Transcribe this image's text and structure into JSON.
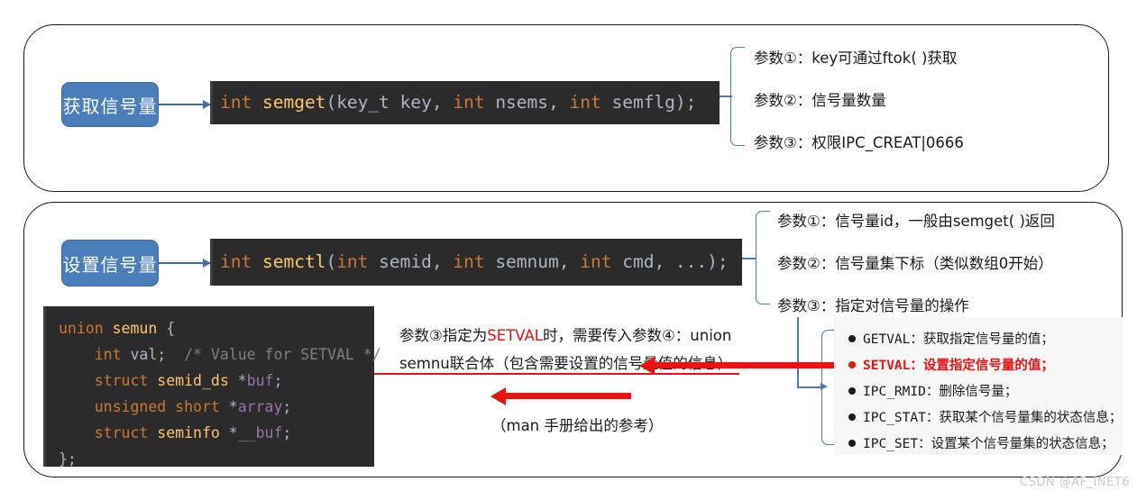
{
  "panels": {
    "semget": {
      "label": "获取信号量",
      "code_plain": "int semget(key_t key, int nsems, int semflg);",
      "code_tokens": [
        {
          "t": "int",
          "c": "kw"
        },
        {
          "t": " ",
          "c": "pn"
        },
        {
          "t": "semget",
          "c": "fn"
        },
        {
          "t": "(",
          "c": "pn"
        },
        {
          "t": "key_t",
          "c": "id"
        },
        {
          "t": " key, ",
          "c": "id"
        },
        {
          "t": "int",
          "c": "kw"
        },
        {
          "t": " nsems, ",
          "c": "id"
        },
        {
          "t": "int",
          "c": "kw"
        },
        {
          "t": " semflg);",
          "c": "id"
        }
      ],
      "annotations": [
        "参数①：key可通过ftok( )获取",
        "参数②：信号量数量",
        "参数③：权限IPC_CREAT|0666"
      ]
    },
    "semctl": {
      "label": "设置信号量",
      "code_plain": "int semctl(int semid, int semnum, int cmd, ...);",
      "code_tokens": [
        {
          "t": "int",
          "c": "kw"
        },
        {
          "t": " ",
          "c": "pn"
        },
        {
          "t": "semctl",
          "c": "fn"
        },
        {
          "t": "(",
          "c": "pn"
        },
        {
          "t": "int",
          "c": "kw"
        },
        {
          "t": " semid, ",
          "c": "id"
        },
        {
          "t": "int",
          "c": "kw"
        },
        {
          "t": " semnum, ",
          "c": "id"
        },
        {
          "t": "int",
          "c": "kw"
        },
        {
          "t": " cmd, ...);",
          "c": "id"
        }
      ],
      "annotations": [
        "参数①：信号量id，一般由semget( )返回",
        "参数②：信号量集下标（类似数组0开始）",
        "参数③：指定对信号量的操作"
      ]
    }
  },
  "union_code": {
    "lines": [
      [
        {
          "t": "union",
          "c": "kw"
        },
        {
          "t": " ",
          "c": "pn"
        },
        {
          "t": "semun",
          "c": "fn"
        },
        {
          "t": " {",
          "c": "pn"
        }
      ],
      [
        {
          "t": "    ",
          "c": "pn"
        },
        {
          "t": "int",
          "c": "kw"
        },
        {
          "t": " val;  ",
          "c": "id"
        },
        {
          "t": "/* Value for SETVAL */",
          "c": "cm"
        }
      ],
      [
        {
          "t": "    ",
          "c": "pn"
        },
        {
          "t": "struct",
          "c": "kw"
        },
        {
          "t": " ",
          "c": "pn"
        },
        {
          "t": "semid_ds",
          "c": "fn"
        },
        {
          "t": " *",
          "c": "pn"
        },
        {
          "t": "buf",
          "c": "ptr"
        },
        {
          "t": ";",
          "c": "pn"
        }
      ],
      [
        {
          "t": "    ",
          "c": "pn"
        },
        {
          "t": "unsigned short",
          "c": "kw"
        },
        {
          "t": " *",
          "c": "pn"
        },
        {
          "t": "array",
          "c": "ptr"
        },
        {
          "t": ";",
          "c": "pn"
        }
      ],
      [
        {
          "t": "    ",
          "c": "pn"
        },
        {
          "t": "struct",
          "c": "kw"
        },
        {
          "t": " ",
          "c": "pn"
        },
        {
          "t": "seminfo",
          "c": "fn"
        },
        {
          "t": " *",
          "c": "pn"
        },
        {
          "t": "__buf",
          "c": "ptr"
        },
        {
          "t": ";",
          "c": "pn"
        }
      ],
      [
        {
          "t": "};",
          "c": "pn"
        }
      ]
    ]
  },
  "middle_note": {
    "line1_pre": "参数③指定为",
    "line1_red": "SETVAL",
    "line1_post": "时，需要传入参数④：union",
    "line2": "semnu联合体（包含需要设置的信号量值的信息）",
    "caption": "（man 手册给出的参考）"
  },
  "cmd_list": [
    {
      "name": "GETVAL：",
      "desc": "获取指定信号量的值；",
      "highlight": false
    },
    {
      "name": "SETVAL：",
      "desc": "设置指定信号量的值；",
      "highlight": true
    },
    {
      "name": "IPC_RMID：",
      "desc": "删除信号量；",
      "highlight": false
    },
    {
      "name": "IPC_STAT：",
      "desc": "获取某个信号量集的状态信息；",
      "highlight": false
    },
    {
      "name": "IPC_SET：",
      "desc": "设置某个信号量集的状态信息；",
      "highlight": false
    }
  ],
  "watermark": "CSDN @AF_INET6",
  "colors": {
    "pill_blue": "#4a7ebb",
    "connector_blue": "#4a7ebb",
    "highlight_red": "#ee1111",
    "code_bg": "#2b2b2b",
    "keyword_orange": "#cc7832",
    "fn_yellow": "#ffc66d",
    "ptr_purple": "#9876aa"
  }
}
